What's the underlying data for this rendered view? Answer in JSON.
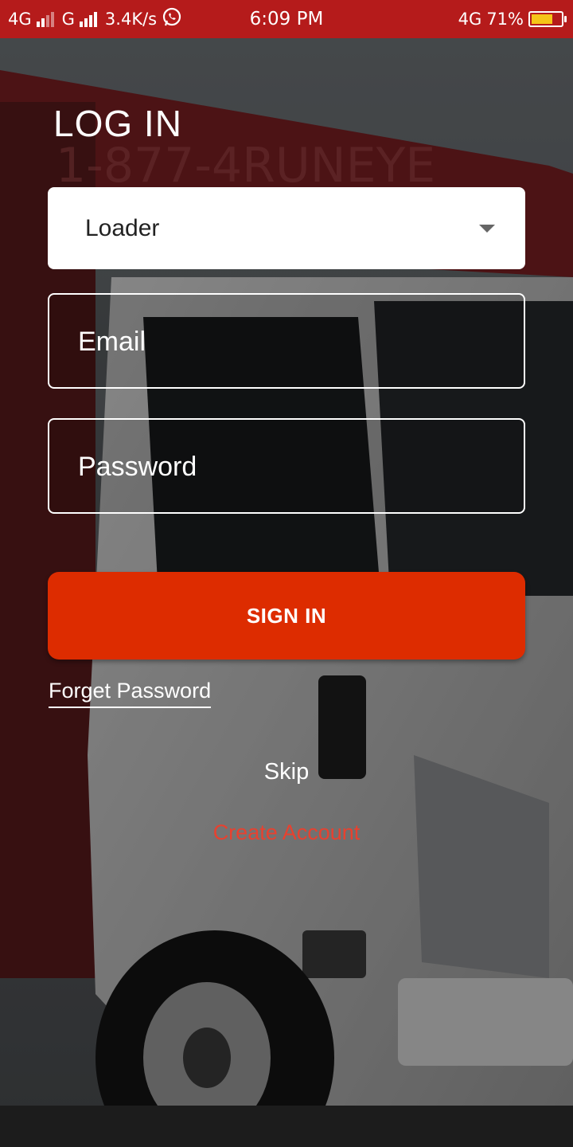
{
  "status_bar": {
    "network_1": "4G",
    "network_2": "G",
    "speed": "3.4K/s",
    "time": "6:09 PM",
    "network_right": "4G",
    "battery_percent": "71%",
    "battery_level": 0.71,
    "icons": [
      "signal-icon",
      "whatsapp-icon",
      "battery-icon"
    ]
  },
  "login": {
    "title": "LOG IN",
    "role_select": {
      "selected": "Loader"
    },
    "email": {
      "placeholder": "Email",
      "value": ""
    },
    "password": {
      "placeholder": "Password",
      "value": ""
    },
    "sign_in_label": "SIGN IN",
    "forget_password_label": "Forget Password",
    "skip_label": "Skip",
    "create_account_label": "Create Account"
  },
  "colors": {
    "status_bar": "#b51b1b",
    "primary_button": "#dd2c00",
    "create_account_text": "#e8412f",
    "battery_fill": "#f5c518"
  }
}
